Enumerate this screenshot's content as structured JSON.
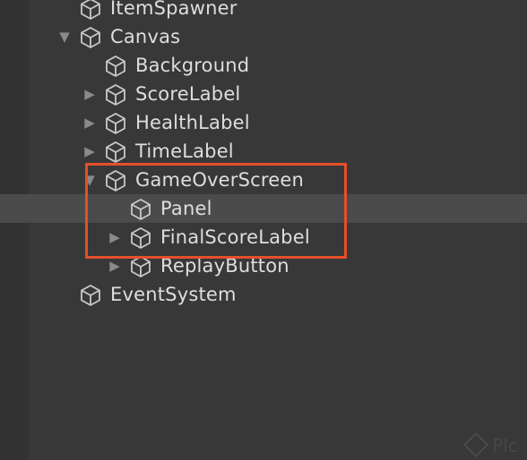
{
  "hierarchy": {
    "items": [
      {
        "label": "ItemSpawner",
        "icon": "gameobject-cube-icon",
        "depth": 0,
        "expander": "none"
      },
      {
        "label": "Canvas",
        "icon": "gameobject-cube-icon",
        "depth": 0,
        "expander": "expanded"
      },
      {
        "label": "Background",
        "icon": "gameobject-cube-icon",
        "depth": 1,
        "expander": "none"
      },
      {
        "label": "ScoreLabel",
        "icon": "gameobject-cube-icon",
        "depth": 1,
        "expander": "collapsed"
      },
      {
        "label": "HealthLabel",
        "icon": "gameobject-cube-icon",
        "depth": 1,
        "expander": "collapsed"
      },
      {
        "label": "TimeLabel",
        "icon": "gameobject-cube-icon",
        "depth": 1,
        "expander": "collapsed"
      },
      {
        "label": "GameOverScreen",
        "icon": "gameobject-cube-icon",
        "depth": 1,
        "expander": "expanded"
      },
      {
        "label": "Panel",
        "icon": "gameobject-cube-icon",
        "depth": 2,
        "expander": "none",
        "selected": true
      },
      {
        "label": "FinalScoreLabel",
        "icon": "gameobject-cube-icon",
        "depth": 2,
        "expander": "collapsed"
      },
      {
        "label": "ReplayButton",
        "icon": "gameobject-cube-icon",
        "depth": 2,
        "expander": "collapsed"
      },
      {
        "label": "EventSystem",
        "icon": "gameobject-cube-icon",
        "depth": 0,
        "expander": "none"
      }
    ]
  },
  "annotation": {
    "color": "#e4502a"
  },
  "colors": {
    "background": "#383838",
    "gutter": "#323232",
    "selected_row": "#4b4b4b",
    "text": "#dedede",
    "icon": "#c9c9c9"
  },
  "watermark": {
    "text": "Plc"
  }
}
